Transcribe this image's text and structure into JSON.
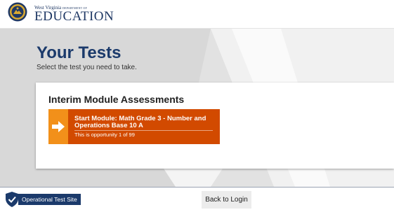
{
  "header": {
    "logo_line1": "West Virginia",
    "logo_dept": "DEPARTMENT OF",
    "logo_line2": "EDUCATION"
  },
  "main": {
    "title": "Your Tests",
    "subtitle": "Select the test you need to take."
  },
  "card": {
    "title": "Interim Module Assessments",
    "test": {
      "name": "Start Module: Math Grade 3 - Number and Operations Base 10 A",
      "opportunity": "This is opportunity 1 of 99"
    }
  },
  "footer": {
    "site_label": "Operational Test Site",
    "back_button": "Back to Login"
  },
  "colors": {
    "title_blue": "#1b3a6b",
    "test_button": "#d24a00",
    "arrow_box": "#f2901a",
    "background_gray": "#e2e2e2"
  },
  "icons": {
    "logo": "wv-department-seal-icon",
    "test_arrow": "arrow-right-icon",
    "site_badge": "shield-check-icon"
  }
}
